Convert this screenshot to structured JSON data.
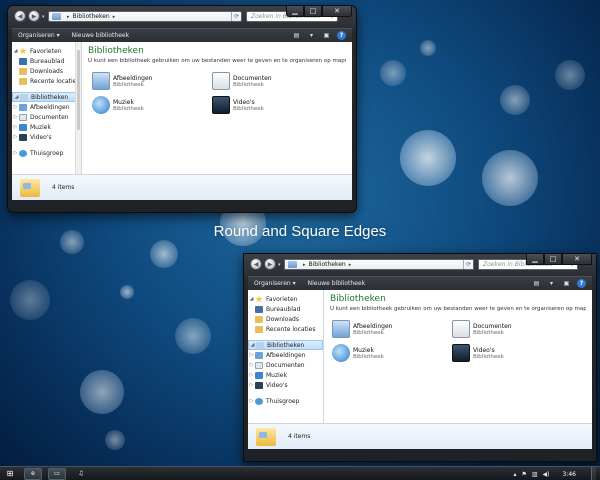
{
  "desktop": {
    "caption": "Round and Square Edges"
  },
  "windows": {
    "round": {
      "breadcrumb": "Bibliotheken",
      "search_placeholder": "Zoeken in Bibliotheken",
      "toolbar": {
        "organize": "Organiseren",
        "new_library": "Nieuwe bibliotheek"
      },
      "nav": {
        "favorites": "Favorieten",
        "desktop": "Bureaublad",
        "downloads": "Downloads",
        "recent": "Recente locaties",
        "libraries": "Bibliotheken",
        "pictures": "Afbeeldingen",
        "documents": "Documenten",
        "music": "Muziek",
        "videos": "Video's",
        "homegroup": "Thuisgroep"
      },
      "content": {
        "title": "Bibliotheken",
        "description": "U kunt een bibliotheek gebruiken om uw bestanden weer te geven en te organiseren op mapnaam...",
        "items": [
          {
            "name": "Afbeeldingen",
            "type": "Bibliotheek"
          },
          {
            "name": "Documenten",
            "type": "Bibliotheek"
          },
          {
            "name": "Muziek",
            "type": "Bibliotheek"
          },
          {
            "name": "Video's",
            "type": "Bibliotheek"
          }
        ]
      },
      "details": "4 items"
    },
    "square": {
      "breadcrumb": "Bibliotheken",
      "search_placeholder": "Zoeken in Bibliotheken",
      "toolbar": {
        "organize": "Organiseren",
        "new_library": "Nieuwe bibliotheek"
      },
      "nav": {
        "favorites": "Favorieten",
        "desktop": "Bureaublad",
        "downloads": "Downloads",
        "recent": "Recente locaties",
        "libraries": "Bibliotheken",
        "pictures": "Afbeeldingen",
        "documents": "Documenten",
        "music": "Muziek",
        "videos": "Video's",
        "homegroup": "Thuisgroep"
      },
      "content": {
        "title": "Bibliotheken",
        "description": "U kunt een bibliotheek gebruiken om uw bestanden weer te geven en te organiseren op mapnaam...",
        "items": [
          {
            "name": "Afbeeldingen",
            "type": "Bibliotheek"
          },
          {
            "name": "Documenten",
            "type": "Bibliotheek"
          },
          {
            "name": "Muziek",
            "type": "Bibliotheek"
          },
          {
            "name": "Video's",
            "type": "Bibliotheek"
          }
        ]
      },
      "details": "4 items"
    }
  },
  "taskbar": {
    "clock": "3:46"
  },
  "colors": {
    "library_title": "#1e7a2c",
    "selection": "#c1dcf7",
    "desktop_blue": "#0f4a7e"
  }
}
